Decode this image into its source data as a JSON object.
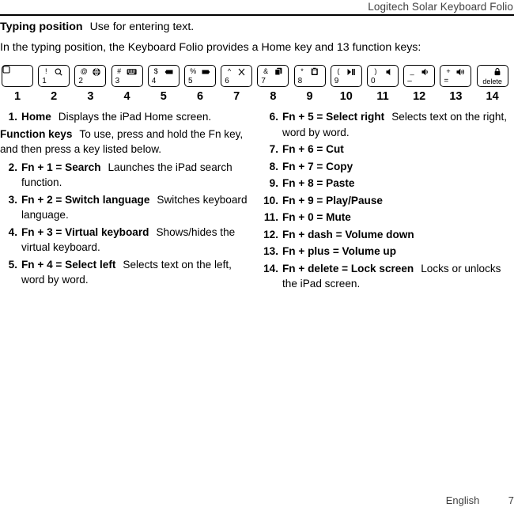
{
  "header": {
    "title": "Logitech Solar Keyboard Folio"
  },
  "intro": {
    "heading": "Typing position",
    "heading_desc": "Use for entering text.",
    "paragraph": "In the typing position, the Keyboard Folio provides a Home key and 13 function keys:"
  },
  "keys": [
    {
      "number": "1",
      "type": "home",
      "top_left": "",
      "top_right": "home-square-icon",
      "legend": ""
    },
    {
      "number": "2",
      "type": "normal",
      "top_left": "!",
      "top_right": "search-icon",
      "legend": "1"
    },
    {
      "number": "3",
      "type": "normal",
      "top_left": "@",
      "top_right": "globe-icon",
      "legend": "2"
    },
    {
      "number": "4",
      "type": "normal",
      "top_left": "#",
      "top_right": "keyboard-icon",
      "legend": "3"
    },
    {
      "number": "5",
      "type": "normal",
      "top_left": "$",
      "top_right": "select-left-icon",
      "legend": "4"
    },
    {
      "number": "6",
      "type": "normal",
      "top_left": "%",
      "top_right": "select-right-icon",
      "legend": "5"
    },
    {
      "number": "7",
      "type": "normal",
      "top_left": "^",
      "top_right": "scissors-icon",
      "legend": "6"
    },
    {
      "number": "8",
      "type": "normal",
      "top_left": "&",
      "top_right": "copy-icon",
      "legend": "7"
    },
    {
      "number": "9",
      "type": "normal",
      "top_left": "*",
      "top_right": "paste-icon",
      "legend": "8"
    },
    {
      "number": "10",
      "type": "normal",
      "top_left": "(",
      "top_right": "play-pause-icon",
      "legend": "9"
    },
    {
      "number": "11",
      "type": "normal",
      "top_left": ")",
      "top_right": "mute-icon",
      "legend": "0"
    },
    {
      "number": "12",
      "type": "normal",
      "top_left": "_",
      "top_right": "volume-down-icon",
      "legend": "–"
    },
    {
      "number": "13",
      "type": "normal",
      "top_left": "+",
      "top_right": "volume-up-icon",
      "legend": "="
    },
    {
      "number": "14",
      "type": "delete",
      "top_left": "",
      "top_right": "lock-icon",
      "legend": "delete"
    }
  ],
  "left_column": {
    "item1": {
      "num": "1.",
      "term": "Home",
      "desc": "Displays the iPad Home screen."
    },
    "fn_heading": "Function keys",
    "fn_desc": "To use, press and hold the Fn key, and then press a key listed below.",
    "items": [
      {
        "num": "2.",
        "term": "Fn + 1 = Search",
        "desc": "Launches the iPad search function."
      },
      {
        "num": "3.",
        "term": "Fn + 2 = Switch language",
        "desc": "Switches keyboard language."
      },
      {
        "num": "4.",
        "term": "Fn + 3 = Virtual keyboard",
        "desc": "Shows/hides the virtual keyboard."
      },
      {
        "num": "5.",
        "term": "Fn + 4 = Select left",
        "desc": "Selects text on the left, word by word."
      }
    ]
  },
  "right_column": {
    "items": [
      {
        "num": "6.",
        "term": "Fn + 5 = Select right",
        "desc": "Selects text on the right, word by word."
      },
      {
        "num": "7.",
        "term": "Fn + 6 = Cut",
        "desc": ""
      },
      {
        "num": "8.",
        "term": "Fn + 7 = Copy",
        "desc": ""
      },
      {
        "num": "9.",
        "term": "Fn + 8 = Paste",
        "desc": ""
      },
      {
        "num": "10.",
        "term": "Fn + 9 = Play/Pause",
        "desc": ""
      },
      {
        "num": "11.",
        "term": "Fn + 0 = Mute",
        "desc": ""
      },
      {
        "num": "12.",
        "term": "Fn + dash = Volume down",
        "desc": ""
      },
      {
        "num": "13.",
        "term": "Fn + plus = Volume up",
        "desc": ""
      },
      {
        "num": "14.",
        "term": "Fn + delete = Lock screen",
        "desc": "Locks or unlocks the iPad screen."
      }
    ]
  },
  "footer": {
    "language": "English",
    "page_number": "7"
  },
  "colors": {
    "text": "#000000",
    "muted": "#3f3f3f",
    "rule": "#000000",
    "background": "#ffffff"
  }
}
